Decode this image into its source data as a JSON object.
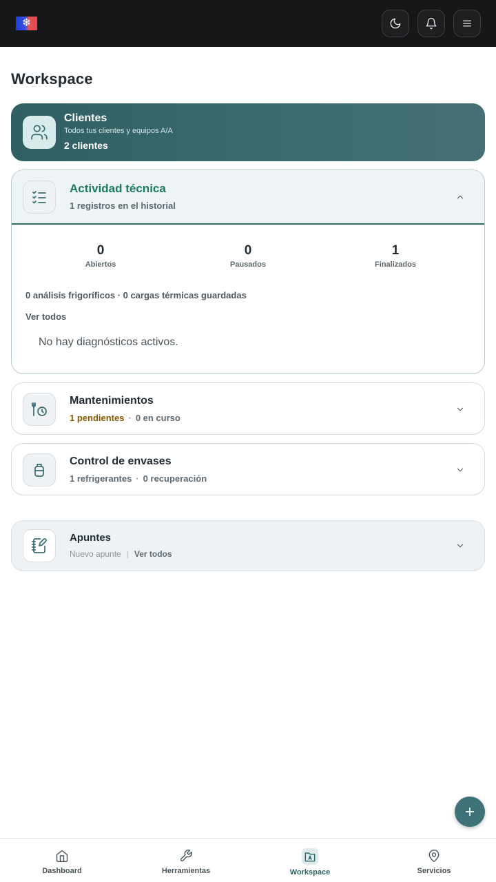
{
  "header": {
    "logo_glyph": "❄",
    "actions": [
      {
        "id": "theme",
        "icon": "moon-icon"
      },
      {
        "id": "notifications",
        "icon": "bell-icon"
      },
      {
        "id": "menu",
        "icon": "menu-icon"
      }
    ]
  },
  "page": {
    "title": "Workspace"
  },
  "clients": {
    "title": "Clientes",
    "subtitle": "Todos tus clientes y equipos A/A",
    "count": "2 clientes"
  },
  "activity": {
    "title": "Actividad técnica",
    "subtitle": "1 registros en el historial",
    "stats": [
      {
        "value": "0",
        "label": "Abiertos"
      },
      {
        "value": "0",
        "label": "Pausados"
      },
      {
        "value": "1",
        "label": "Finalizados"
      }
    ],
    "summary": "0 análisis frigoríficos · 0 cargas térmicas guardadas",
    "see_all": "Ver todos",
    "empty": "No hay diagnósticos activos."
  },
  "maintenance": {
    "title": "Mantenimientos",
    "pending": "1 pendientes",
    "separator": "·",
    "in_progress": "0 en curso"
  },
  "containers": {
    "title": "Control de envases",
    "refrigerants": "1 refrigerantes",
    "separator": "·",
    "recovery": "0 recuperación"
  },
  "notes": {
    "title": "Apuntes",
    "new_note": "Nuevo apunte",
    "see_all": "Ver todos"
  },
  "bottom_nav": [
    {
      "label": "Dashboard",
      "icon": "home-icon"
    },
    {
      "label": "Herramientas",
      "icon": "wrench-icon"
    },
    {
      "label": "Workspace",
      "icon": "workspace-icon",
      "active": true
    },
    {
      "label": "Servicios",
      "icon": "map-pin-icon"
    }
  ],
  "colors": {
    "accent": "#3d7276",
    "activity_title": "#1b7a5c",
    "pending": "#8a5a00",
    "topbar": "#161718"
  }
}
